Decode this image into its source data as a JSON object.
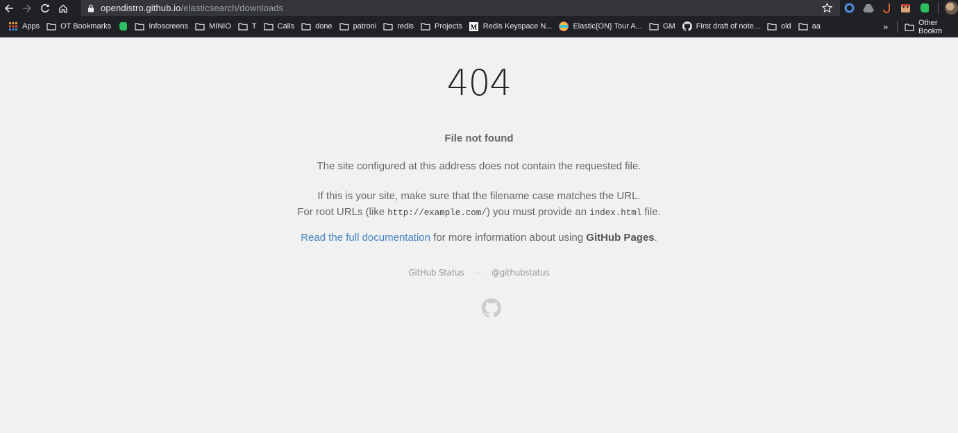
{
  "browser": {
    "url_host": "opendistro.github.io",
    "url_path": "/elasticsearch/downloads",
    "bookmarks": [
      {
        "label": "Apps",
        "icon": "apps-grid-icon"
      },
      {
        "label": "OT Bookmarks",
        "icon": "folder-icon"
      },
      {
        "label": "",
        "icon": "evernote-icon"
      },
      {
        "label": "Infoscreens",
        "icon": "folder-icon"
      },
      {
        "label": "MINIO",
        "icon": "folder-icon"
      },
      {
        "label": "T",
        "icon": "folder-icon"
      },
      {
        "label": "Calls",
        "icon": "folder-icon"
      },
      {
        "label": "done",
        "icon": "folder-icon"
      },
      {
        "label": "patroni",
        "icon": "folder-icon"
      },
      {
        "label": "redis",
        "icon": "folder-icon"
      },
      {
        "label": "Projects",
        "icon": "folder-icon"
      },
      {
        "label": "Redis Keyspace N...",
        "icon": "medium-icon"
      },
      {
        "label": "Elastic{ON} Tour A...",
        "icon": "globe-icon"
      },
      {
        "label": "GM",
        "icon": "folder-icon"
      },
      {
        "label": "First draft of note...",
        "icon": "github-icon"
      },
      {
        "label": "old",
        "icon": "folder-icon"
      },
      {
        "label": "aa",
        "icon": "folder-icon"
      }
    ],
    "overflow": "»",
    "other_bookmarks": "Other Bookm"
  },
  "page": {
    "code": "404",
    "title": "File not found",
    "p1": "The site configured at this address does not contain the requested file.",
    "p2_line1": "If this is your site, make sure that the filename case matches the URL.",
    "p2_a": "For root URLs (like ",
    "p2_code1": "http://example.com/",
    "p2_b": ") you must provide an ",
    "p2_code2": "index.html",
    "p2_c": " file.",
    "p3_link": "Read the full documentation",
    "p3_text": " for more information about using ",
    "p3_bold": "GitHub Pages",
    "p3_end": ".",
    "footer_status": "GitHub Status",
    "footer_dash": "—",
    "footer_twitter": "@githubstatus"
  },
  "colors": {
    "chrome_bg": "#202124",
    "page_bg": "#f1f1f1",
    "link": "#4183c4"
  }
}
